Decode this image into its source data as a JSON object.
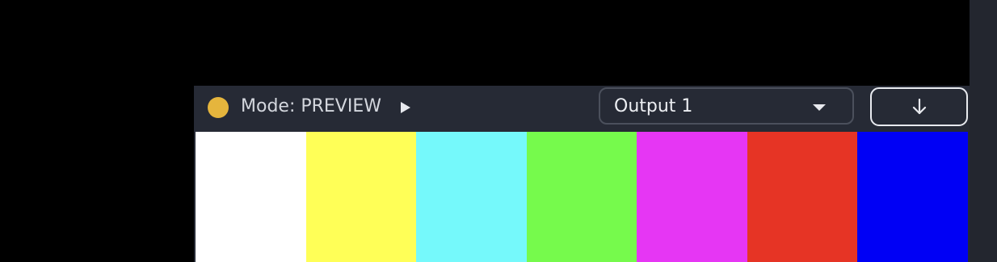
{
  "toolbar": {
    "status_color": "#e5b53d",
    "mode_text": "Mode: PREVIEW",
    "play_icon": "play-icon",
    "output_select": {
      "value": "Output 1",
      "icon": "chevron-down-icon"
    },
    "download_button": {
      "icon": "arrow-down-icon"
    }
  },
  "preview": {
    "bars": [
      {
        "name": "white",
        "color": "#ffffff"
      },
      {
        "name": "yellow",
        "color": "#ffff57"
      },
      {
        "name": "cyan",
        "color": "#75f9fb"
      },
      {
        "name": "green",
        "color": "#76fa4c"
      },
      {
        "name": "magenta",
        "color": "#e636f4"
      },
      {
        "name": "red",
        "color": "#e63425"
      },
      {
        "name": "blue",
        "color": "#0000f5"
      }
    ]
  }
}
